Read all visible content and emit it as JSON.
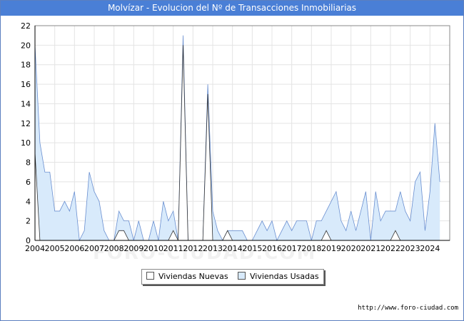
{
  "title": "Molvízar - Evolucion del Nº de Transacciones Inmobiliarias",
  "url": "http://www.foro-ciudad.com",
  "watermark": "FORO-CIUDAD.COM",
  "colors": {
    "title_bg": "#4a7fd6",
    "usadas_fill": "#d8eafb",
    "usadas_line": "#6a8fd0",
    "nuevas_fill": "#ffffff",
    "nuevas_line": "#333333",
    "grid": "#e4e4e4"
  },
  "chart_data": {
    "type": "area",
    "xlim": [
      2004,
      2025
    ],
    "ylim": [
      0,
      22
    ],
    "yticks": [
      0,
      2,
      4,
      6,
      8,
      10,
      12,
      14,
      16,
      18,
      20,
      22
    ],
    "xticks": [
      "2004",
      "2005",
      "2006",
      "2007",
      "2008",
      "2009",
      "2010",
      "2011",
      "2012",
      "2013",
      "2014",
      "2015",
      "2016",
      "2017",
      "2018",
      "2019",
      "2020",
      "2021",
      "2022",
      "2023",
      "2024"
    ],
    "grid": true,
    "legend_position": "bottom",
    "series": [
      {
        "name": "Viviendas Usadas",
        "points": [
          [
            2004.0,
            20
          ],
          [
            2004.25,
            10
          ],
          [
            2004.5,
            7
          ],
          [
            2004.75,
            7
          ],
          [
            2005.0,
            3
          ],
          [
            2005.25,
            3
          ],
          [
            2005.5,
            4
          ],
          [
            2005.75,
            3
          ],
          [
            2006.0,
            5
          ],
          [
            2006.25,
            0
          ],
          [
            2006.5,
            1
          ],
          [
            2006.75,
            7
          ],
          [
            2007.0,
            5
          ],
          [
            2007.25,
            4
          ],
          [
            2007.5,
            1
          ],
          [
            2007.75,
            0
          ],
          [
            2008.0,
            0
          ],
          [
            2008.25,
            3
          ],
          [
            2008.5,
            2
          ],
          [
            2008.75,
            2
          ],
          [
            2009.0,
            0
          ],
          [
            2009.25,
            2
          ],
          [
            2009.5,
            0
          ],
          [
            2009.75,
            0
          ],
          [
            2010.0,
            2
          ],
          [
            2010.25,
            0
          ],
          [
            2010.5,
            4
          ],
          [
            2010.75,
            2
          ],
          [
            2011.0,
            3
          ],
          [
            2011.25,
            0
          ],
          [
            2011.5,
            21
          ],
          [
            2011.75,
            0
          ],
          [
            2012.0,
            0
          ],
          [
            2012.25,
            0
          ],
          [
            2012.5,
            0
          ],
          [
            2012.75,
            16
          ],
          [
            2013.0,
            3
          ],
          [
            2013.25,
            1
          ],
          [
            2013.5,
            0
          ],
          [
            2013.75,
            1
          ],
          [
            2014.0,
            1
          ],
          [
            2014.25,
            1
          ],
          [
            2014.5,
            1
          ],
          [
            2014.75,
            0
          ],
          [
            2015.0,
            0
          ],
          [
            2015.25,
            1
          ],
          [
            2015.5,
            2
          ],
          [
            2015.75,
            1
          ],
          [
            2016.0,
            2
          ],
          [
            2016.25,
            0
          ],
          [
            2016.5,
            1
          ],
          [
            2016.75,
            2
          ],
          [
            2017.0,
            1
          ],
          [
            2017.25,
            2
          ],
          [
            2017.5,
            2
          ],
          [
            2017.75,
            2
          ],
          [
            2018.0,
            0
          ],
          [
            2018.25,
            2
          ],
          [
            2018.5,
            2
          ],
          [
            2018.75,
            3
          ],
          [
            2019.0,
            4
          ],
          [
            2019.25,
            5
          ],
          [
            2019.5,
            2
          ],
          [
            2019.75,
            1
          ],
          [
            2020.0,
            3
          ],
          [
            2020.25,
            1
          ],
          [
            2020.5,
            3
          ],
          [
            2020.75,
            5
          ],
          [
            2021.0,
            0
          ],
          [
            2021.25,
            5
          ],
          [
            2021.5,
            2
          ],
          [
            2021.75,
            3
          ],
          [
            2022.0,
            3
          ],
          [
            2022.25,
            3
          ],
          [
            2022.5,
            5
          ],
          [
            2022.75,
            3
          ],
          [
            2023.0,
            2
          ],
          [
            2023.25,
            6
          ],
          [
            2023.5,
            7
          ],
          [
            2023.75,
            1
          ],
          [
            2024.0,
            5
          ],
          [
            2024.25,
            12
          ],
          [
            2024.5,
            6
          ]
        ]
      },
      {
        "name": "Viviendas Nuevas",
        "points": [
          [
            2004.0,
            9
          ],
          [
            2004.25,
            0
          ],
          [
            2004.5,
            0
          ],
          [
            2004.75,
            0
          ],
          [
            2005.0,
            0
          ],
          [
            2005.25,
            0
          ],
          [
            2005.5,
            0
          ],
          [
            2005.75,
            0
          ],
          [
            2006.0,
            0
          ],
          [
            2006.25,
            0
          ],
          [
            2006.5,
            0
          ],
          [
            2006.75,
            0
          ],
          [
            2007.0,
            0
          ],
          [
            2007.25,
            0
          ],
          [
            2007.5,
            0
          ],
          [
            2007.75,
            0
          ],
          [
            2008.0,
            0
          ],
          [
            2008.25,
            1
          ],
          [
            2008.5,
            1
          ],
          [
            2008.75,
            0
          ],
          [
            2009.0,
            0
          ],
          [
            2009.25,
            0
          ],
          [
            2009.5,
            0
          ],
          [
            2009.75,
            0
          ],
          [
            2010.0,
            0
          ],
          [
            2010.25,
            0
          ],
          [
            2010.5,
            0
          ],
          [
            2010.75,
            0
          ],
          [
            2011.0,
            1
          ],
          [
            2011.25,
            0
          ],
          [
            2011.5,
            20
          ],
          [
            2011.75,
            0
          ],
          [
            2012.0,
            0
          ],
          [
            2012.25,
            0
          ],
          [
            2012.5,
            0
          ],
          [
            2012.75,
            15
          ],
          [
            2013.0,
            0
          ],
          [
            2013.25,
            0
          ],
          [
            2013.5,
            0
          ],
          [
            2013.75,
            1
          ],
          [
            2014.0,
            0
          ],
          [
            2014.25,
            0
          ],
          [
            2014.5,
            0
          ],
          [
            2014.75,
            0
          ],
          [
            2015.0,
            0
          ],
          [
            2015.25,
            0
          ],
          [
            2015.5,
            0
          ],
          [
            2015.75,
            0
          ],
          [
            2016.0,
            0
          ],
          [
            2016.25,
            0
          ],
          [
            2016.5,
            0
          ],
          [
            2016.75,
            0
          ],
          [
            2017.0,
            0
          ],
          [
            2017.25,
            0
          ],
          [
            2017.5,
            0
          ],
          [
            2017.75,
            0
          ],
          [
            2018.0,
            0
          ],
          [
            2018.25,
            0
          ],
          [
            2018.5,
            0
          ],
          [
            2018.75,
            1
          ],
          [
            2019.0,
            0
          ],
          [
            2019.25,
            0
          ],
          [
            2019.5,
            0
          ],
          [
            2019.75,
            0
          ],
          [
            2020.0,
            0
          ],
          [
            2020.25,
            0
          ],
          [
            2020.5,
            0
          ],
          [
            2020.75,
            0
          ],
          [
            2021.0,
            0
          ],
          [
            2021.25,
            0
          ],
          [
            2021.5,
            0
          ],
          [
            2021.75,
            0
          ],
          [
            2022.0,
            0
          ],
          [
            2022.25,
            1
          ],
          [
            2022.5,
            0
          ],
          [
            2022.75,
            0
          ],
          [
            2023.0,
            0
          ],
          [
            2023.25,
            0
          ],
          [
            2023.5,
            0
          ],
          [
            2023.75,
            0
          ],
          [
            2024.0,
            0
          ],
          [
            2024.25,
            0
          ],
          [
            2024.5,
            0
          ]
        ]
      }
    ]
  }
}
